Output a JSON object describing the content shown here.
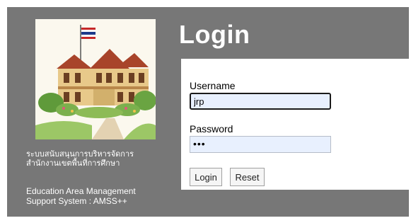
{
  "login": {
    "title": "Login",
    "username_label": "Username",
    "username_value": "jrp",
    "password_label": "Password",
    "password_value": "•••",
    "login_button": "Login",
    "reset_button": "Reset"
  },
  "branding": {
    "thai_line1": "ระบบสนับสนุนการบริหารจัดการ",
    "thai_line2": "สำนักงานเขตพื้นที่การศึกษา",
    "english_line1": "Education Area Management",
    "english_line2": "Support System : AMSS++",
    "image": "school-building-illustration"
  },
  "colors": {
    "panel_bg": "#777777",
    "input_bg": "#e8f0fe"
  }
}
